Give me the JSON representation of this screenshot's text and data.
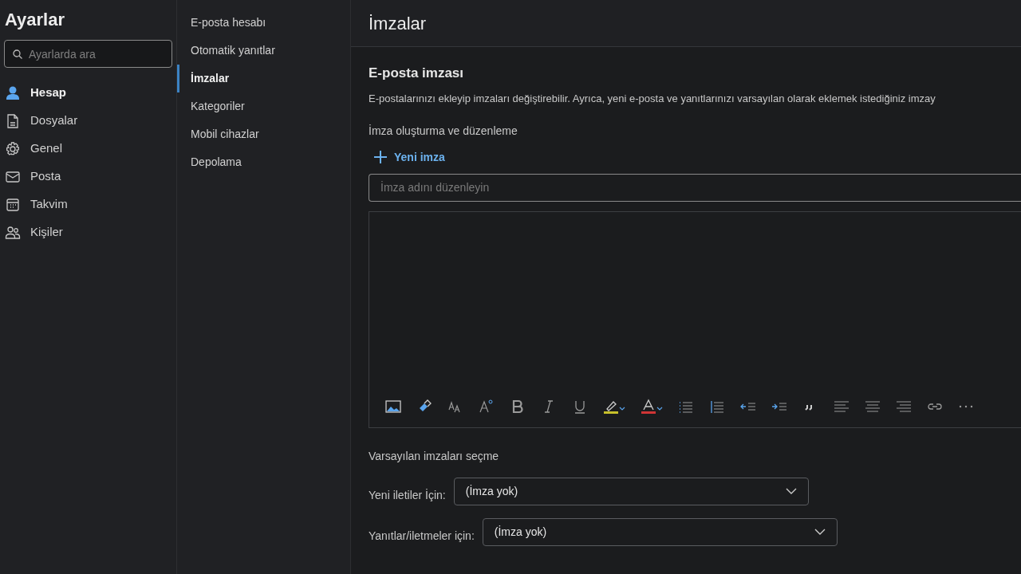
{
  "sidebar": {
    "title": "Ayarlar",
    "search": {
      "placeholder": "Ayarlarda ara"
    },
    "items": [
      {
        "label": "Hesap",
        "selected": true
      },
      {
        "label": "Dosyalar",
        "selected": false
      },
      {
        "label": "Genel",
        "selected": false
      },
      {
        "label": "Posta",
        "selected": false
      },
      {
        "label": "Takvim",
        "selected": false
      },
      {
        "label": "Kişiler",
        "selected": false
      }
    ]
  },
  "subnav": {
    "items": [
      {
        "label": "E-posta hesabı",
        "selected": false
      },
      {
        "label": "Otomatik yanıtlar",
        "selected": false
      },
      {
        "label": "İmzalar",
        "selected": true
      },
      {
        "label": "Kategoriler",
        "selected": false
      },
      {
        "label": "Mobil cihazlar",
        "selected": false
      },
      {
        "label": "Depolama",
        "selected": false
      }
    ]
  },
  "main": {
    "title": "İmzalar",
    "section_title": "E-posta imzası",
    "description": "E-postalarınızı ekleyip imzaları değiştirebilir. Ayrıca, yeni e-posta ve yanıtlarınızı varsayılan olarak eklemek istediğiniz imzay",
    "create_label": "İmza oluşturma ve düzenleme",
    "new_button": "Yeni imza",
    "name_field": {
      "placeholder": "İmza adını düzenleyin"
    },
    "defaults_label": "Varsayılan imzaları seçme",
    "defaults": [
      {
        "label": "Yeni iletiler İçin:",
        "value": "(İmza yok)"
      },
      {
        "label": "Yanıtlar/iletmeler için:",
        "value": "(İmza yok)"
      }
    ]
  }
}
